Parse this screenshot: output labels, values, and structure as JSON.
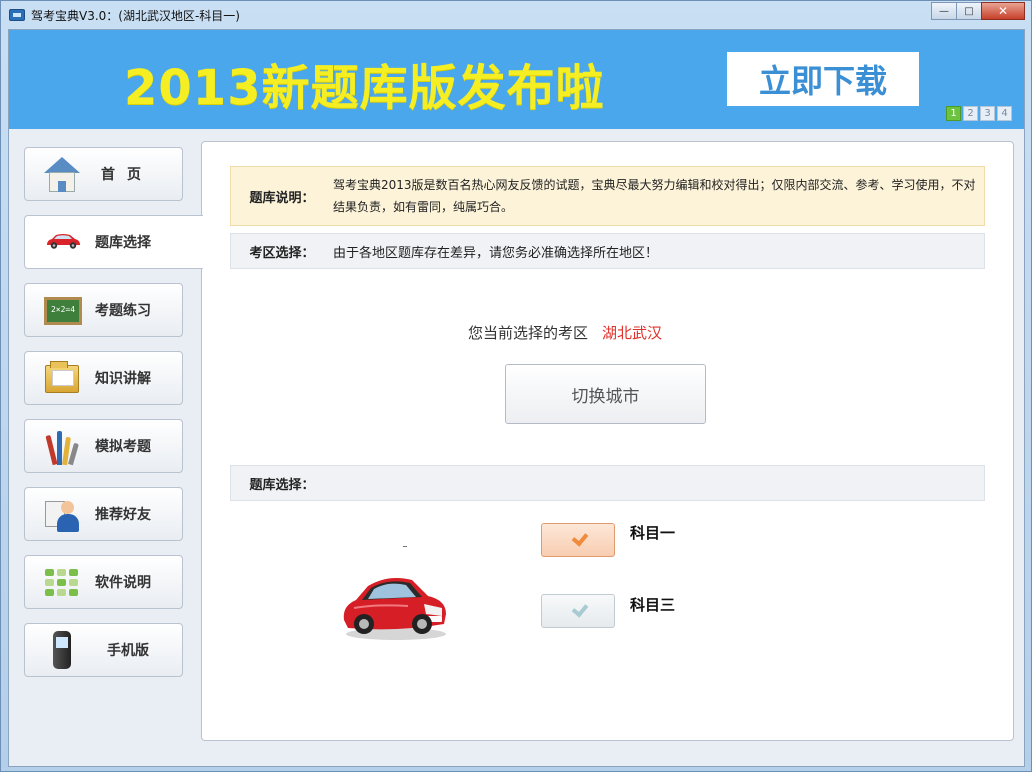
{
  "window": {
    "title": "驾考宝典V3.0：(湖北武汉地区-科目一)",
    "minimize_label": "—",
    "maximize_label": "□",
    "close_label": "✕"
  },
  "banner": {
    "headline": "2013新题库版发布啦",
    "download_label": "立即下载",
    "pager": [
      "1",
      "2",
      "3",
      "4"
    ],
    "active_page": "1"
  },
  "sidebar": {
    "items": [
      {
        "label": "首页",
        "icon": "house-icon"
      },
      {
        "label": "题库选择",
        "icon": "car-icon"
      },
      {
        "label": "考题练习",
        "icon": "chalkboard-icon"
      },
      {
        "label": "知识讲解",
        "icon": "folder-icon"
      },
      {
        "label": "模拟考题",
        "icon": "pens-icon"
      },
      {
        "label": "推荐好友",
        "icon": "person-icon"
      },
      {
        "label": "软件说明",
        "icon": "grid-icon"
      },
      {
        "label": "手机版",
        "icon": "phone-icon"
      }
    ],
    "active_index": 1,
    "board_text": "2×2=4"
  },
  "main": {
    "notice_label": "题库说明：",
    "notice_text": "驾考宝典2013版是数百名热心网友反馈的试题，宝典尽最大努力编辑和校对得出；仅限内部交流、参考、学习使用，不对结果负责，如有雷同，纯属巧合。",
    "region_label": "考区选择：",
    "region_text": "由于各地区题库存在差异，请您务必准确选择所在地区！",
    "current_prefix": "您当前选择的考区",
    "current_city": "湖北武汉",
    "switch_label": "切换城市",
    "bank_label": "题库选择：",
    "subjects": [
      {
        "label": "科目一",
        "checked": true
      },
      {
        "label": "科目三",
        "checked": false
      }
    ]
  },
  "colors": {
    "banner_bg": "#4aa7ec",
    "headline": "#f5ee22",
    "city": "#e0302a",
    "check_active": "#f08a3c"
  }
}
